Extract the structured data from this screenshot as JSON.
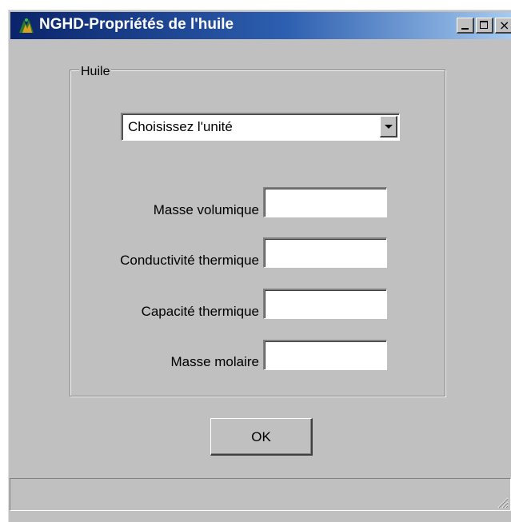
{
  "window": {
    "title": "NGHD-Propriétés de l'huile",
    "icon": "app-icon",
    "controls": {
      "minimize_icon": "minimize-icon",
      "maximize_icon": "maximize-icon",
      "close_icon": "close-icon",
      "close_glyph": "×"
    }
  },
  "group": {
    "legend": "Huile",
    "unit_select": {
      "value": "Choisissez l'unité",
      "icon": "dropdown-arrow-icon"
    },
    "fields": [
      {
        "label": "Masse volumique",
        "value": ""
      },
      {
        "label": "Conductivité thermique",
        "value": ""
      },
      {
        "label": "Capacité thermique",
        "value": ""
      },
      {
        "label": "Masse molaire",
        "value": ""
      }
    ]
  },
  "buttons": {
    "ok_label": "OK"
  },
  "colors": {
    "titlebar_start": "#0a246a",
    "titlebar_end": "#a6caf0",
    "face": "#c0c0c0"
  }
}
